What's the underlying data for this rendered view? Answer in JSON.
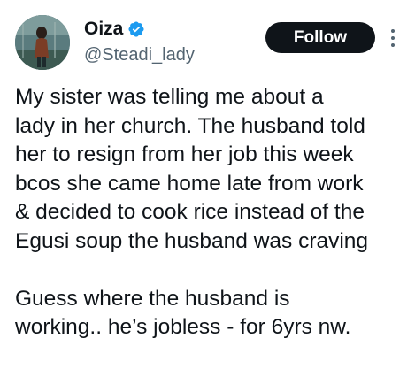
{
  "author": {
    "display_name": "Oiza",
    "handle": "@Steadi_lady",
    "verified": true,
    "avatar_icon": "profile-photo",
    "verified_icon": "verified-badge-icon",
    "verified_color": "#1d9bf0"
  },
  "actions": {
    "follow_label": "Follow",
    "more_icon": "more-vertical-icon"
  },
  "tweet": {
    "paragraphs": [
      {
        "lines": [
          "My sister was telling me about a",
          "lady in her church. The husband told",
          "her to resign from her job this week",
          "bcos she came home late from work",
          "& decided to cook rice instead of the",
          "Egusi soup the husband was craving"
        ]
      },
      {
        "lines": [
          "Guess where the husband is",
          "working.. he’s jobless - for 6yrs nw."
        ]
      }
    ]
  },
  "colors": {
    "text": "#0f1419",
    "secondary_text": "#536471",
    "follow_bg": "#0f1419",
    "follow_text": "#ffffff"
  }
}
